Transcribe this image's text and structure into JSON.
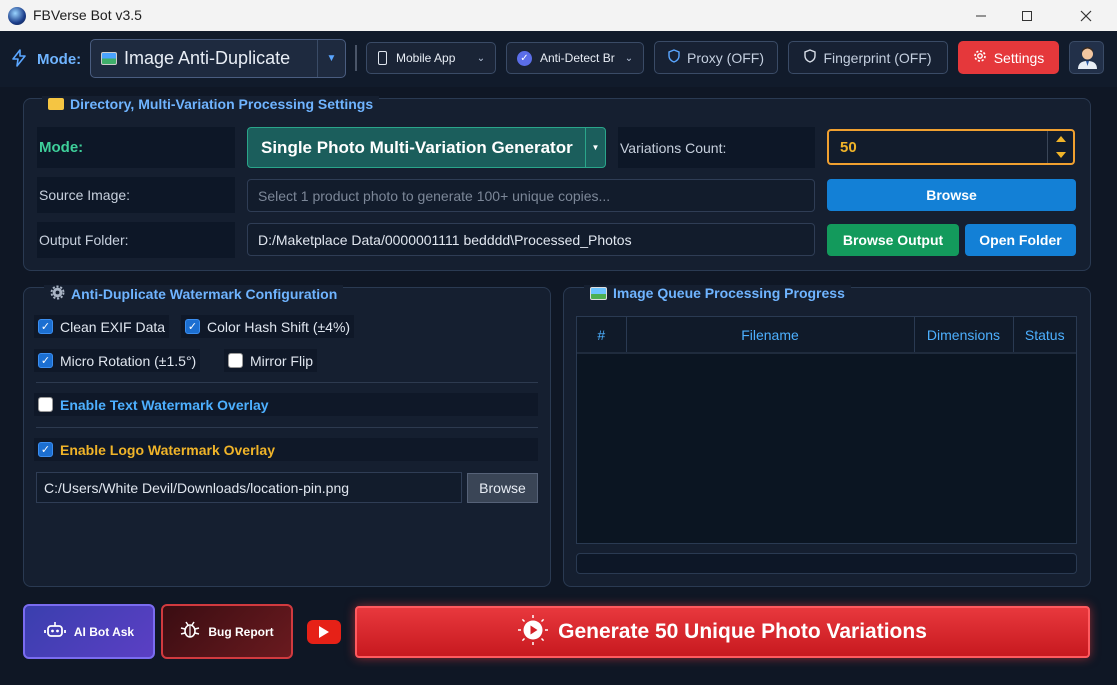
{
  "window": {
    "title": "FBVerse Bot v3.5",
    "minimize_icon": "minimize-icon",
    "maximize_icon": "maximize-icon",
    "close_icon": "close-icon"
  },
  "toolbar": {
    "mode_label": "Mode:",
    "mode_value": "Image Anti-Duplicate",
    "device_value": "Mobile App",
    "browser_value": "Anti-Detect Br",
    "proxy_label": "Proxy (OFF)",
    "fingerprint_label": "Fingerprint (OFF)",
    "settings_label": "Settings"
  },
  "directory_panel": {
    "title": "Directory, Multi-Variation  Processing Settings",
    "mode_label": "Mode:",
    "mode_value": "Single Photo Multi-Variation Generator",
    "variations_label": "Variations Count:",
    "variations_value": "50",
    "source_label": "Source Image:",
    "source_placeholder": "Select 1 product photo to generate 100+ unique copies...",
    "browse_label": "Browse",
    "output_label": "Output Folder:",
    "output_value": "D:/Maketplace Data/0000001111 bedddd\\Processed_Photos",
    "browse_output_label": "Browse Output",
    "open_folder_label": "Open Folder"
  },
  "watermark_panel": {
    "title": "Anti-Duplicate  Watermark Configuration",
    "options": [
      {
        "label": "Clean EXIF Data",
        "checked": true
      },
      {
        "label": "Color Hash Shift (±4%)",
        "checked": true
      },
      {
        "label": "Micro Rotation (±1.5°)",
        "checked": true
      },
      {
        "label": "Mirror Flip",
        "checked": false
      }
    ],
    "text_overlay_label": "Enable Text Watermark Overlay",
    "text_overlay_checked": false,
    "logo_overlay_label": "Enable Logo Watermark Overlay",
    "logo_overlay_checked": true,
    "logo_path": "C:/Users/White Devil/Downloads/location-pin.png",
    "logo_browse_label": "Browse"
  },
  "queue_panel": {
    "title": "Image Queue  Processing Progress",
    "columns": [
      "#",
      "Filename",
      "Dimensions",
      "Status"
    ]
  },
  "footer": {
    "ai_bot_label": "AI Bot Ask",
    "bug_report_label": "Bug Report",
    "generate_label": "Generate 50 Unique Photo Variations"
  },
  "colors": {
    "accent": "#1380d6",
    "danger": "#e5383b",
    "success": "#139a5c",
    "mode_teal": "#1b5e5c",
    "gold": "#f0b429"
  }
}
